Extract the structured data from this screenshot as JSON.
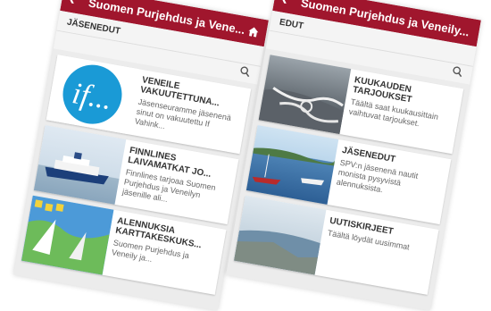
{
  "app_title": "Suomen Purjehdus ja Veneily...",
  "left_screen": {
    "app_title": "Suomen Purjehdus ja Vene...",
    "section_title": "JÄSENEDUT",
    "items": [
      {
        "title": "VENEILE VAKUUTETTUNA...",
        "desc": "Jäsenseuramme jäsenenä sinut on vakuutettu If Vahink..."
      },
      {
        "title": "FINNLINES LAIVAMATKAT JO...",
        "desc": "Finnlines tarjoaa Suomen Purjehdus ja Veneilyn jäsenille ali..."
      },
      {
        "title": "ALENNUKSIA KARTTAKESKUKS...",
        "desc": "Suomen Purjehdus ja Veneily ja..."
      }
    ]
  },
  "right_screen": {
    "app_title": "Suomen Purjehdus ja Veneily...",
    "section_title": "EDUT",
    "items": [
      {
        "title": "KUUKAUDEN TARJOUKSET",
        "desc": "Täältä saat kuukausittain vaihtuvat tarjoukset."
      },
      {
        "title": "JÄSENEDUT",
        "desc": "SPV:n jäsenenä nautit monista pysyvistä alennuksista."
      },
      {
        "title": "UUTISKIRJEET",
        "desc": "Täältä löydät uusimmat"
      }
    ]
  },
  "colors": {
    "brand": "#a0162d",
    "if_blue": "#1a9ad6"
  }
}
